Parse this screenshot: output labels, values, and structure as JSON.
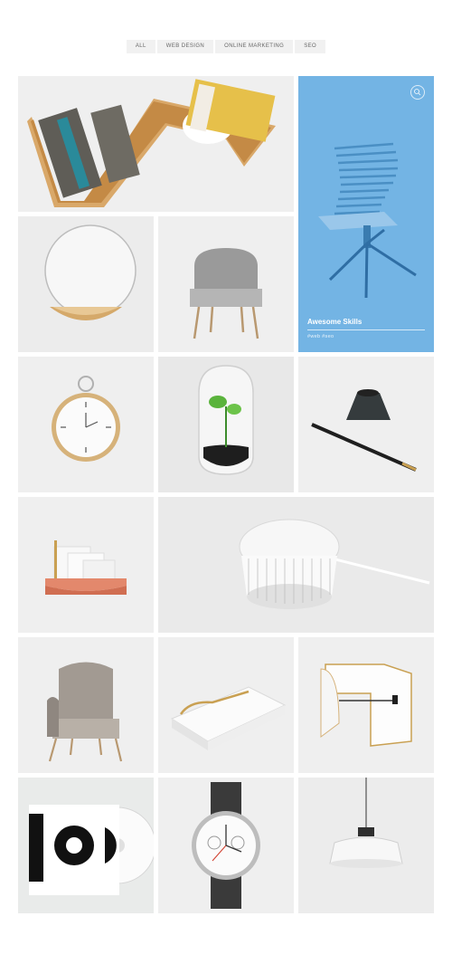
{
  "filters": [
    {
      "label": "ALL"
    },
    {
      "label": "WEB DESIGN"
    },
    {
      "label": "ONLINE MARKETING"
    },
    {
      "label": "SEO"
    }
  ],
  "hover_card": {
    "title": "Awesome Skills",
    "tags": "#web #seo",
    "icon": "search-icon",
    "background": "#73b4e4"
  },
  "portfolio_items": [
    {
      "subject": "bookshelf"
    },
    {
      "subject": "chair-skeleton"
    },
    {
      "subject": "mirror-shelf"
    },
    {
      "subject": "lounge-chair"
    },
    {
      "subject": "pocket-watch"
    },
    {
      "subject": "plant-terrarium"
    },
    {
      "subject": "pen-holder"
    },
    {
      "subject": "letter-holder"
    },
    {
      "subject": "fan-lamp"
    },
    {
      "subject": "armchair"
    },
    {
      "subject": "book-clip"
    },
    {
      "subject": "stool"
    },
    {
      "subject": "vinyl-record"
    },
    {
      "subject": "wrist-watch"
    },
    {
      "subject": "pendant-lamp"
    }
  ]
}
